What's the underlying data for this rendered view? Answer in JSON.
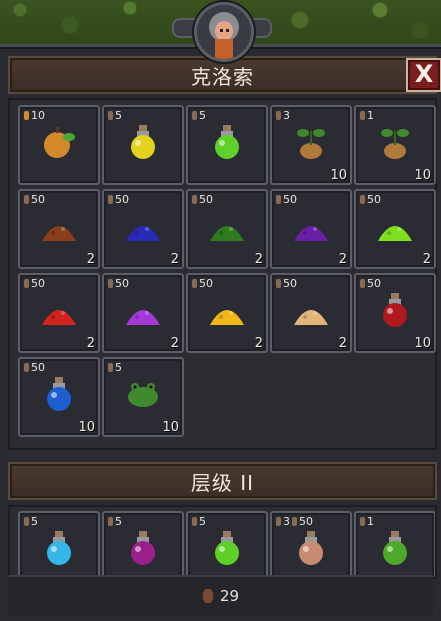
{
  "sections": [
    {
      "title": "克洛索"
    },
    {
      "title": "层级 II"
    }
  ],
  "close_label": "X",
  "items": [
    {
      "icon": "apple-icon",
      "top": "10",
      "bottom": "",
      "pip": "gold",
      "color": "#d28a2a"
    },
    {
      "icon": "yellow-potion-icon",
      "top": "5",
      "bottom": "",
      "color": "#e4d21c"
    },
    {
      "icon": "green-potion-icon",
      "top": "5",
      "bottom": "",
      "color": "#5fcf2a"
    },
    {
      "icon": "mandrake-icon",
      "top": "3",
      "bottom": "10",
      "color": "#b07a3a"
    },
    {
      "icon": "mandrake-icon",
      "top": "1",
      "bottom": "10",
      "color": "#b07a3a"
    },
    {
      "icon": "brown-powder-icon",
      "top": "50",
      "bottom": "2",
      "color": "#8a3e1a"
    },
    {
      "icon": "blue-powder-icon",
      "top": "50",
      "bottom": "2",
      "color": "#2a2ab8"
    },
    {
      "icon": "green-powder-icon",
      "top": "50",
      "bottom": "2",
      "color": "#2f7a1c"
    },
    {
      "icon": "purple-powder-icon",
      "top": "50",
      "bottom": "2",
      "color": "#6a1fa8"
    },
    {
      "icon": "lime-powder-icon",
      "top": "50",
      "bottom": "2",
      "color": "#7ee01e"
    },
    {
      "icon": "red-powder-icon",
      "top": "50",
      "bottom": "2",
      "color": "#d0241c"
    },
    {
      "icon": "violet-powder-icon",
      "top": "50",
      "bottom": "2",
      "color": "#a33ad8"
    },
    {
      "icon": "gold-powder-icon",
      "top": "50",
      "bottom": "2",
      "color": "#f2b81a"
    },
    {
      "icon": "tan-powder-icon",
      "top": "50",
      "bottom": "2",
      "color": "#e2b57a"
    },
    {
      "icon": "red-potion-icon",
      "top": "50",
      "bottom": "10",
      "color": "#b0191d"
    },
    {
      "icon": "blue-potion-icon",
      "top": "50",
      "bottom": "10",
      "color": "#1e5fd0"
    },
    {
      "icon": "frog-icon",
      "top": "5",
      "bottom": "10",
      "color": "#3f8a2c"
    }
  ],
  "tier2": [
    {
      "icon": "cyan-potion-icon",
      "top": "5",
      "color": "#34b7e8"
    },
    {
      "icon": "magenta-potion-icon",
      "top": "5",
      "color": "#9b1f8a"
    },
    {
      "icon": "green-potion-icon",
      "top": "5",
      "color": "#5fcf2a"
    },
    {
      "icon": "peach-potion-icon",
      "top": "3",
      "top2": "50",
      "color": "#c98c72"
    },
    {
      "icon": "green-potion-icon",
      "top": "1",
      "color": "#4ea82a"
    }
  ],
  "footer": {
    "count": "29"
  }
}
